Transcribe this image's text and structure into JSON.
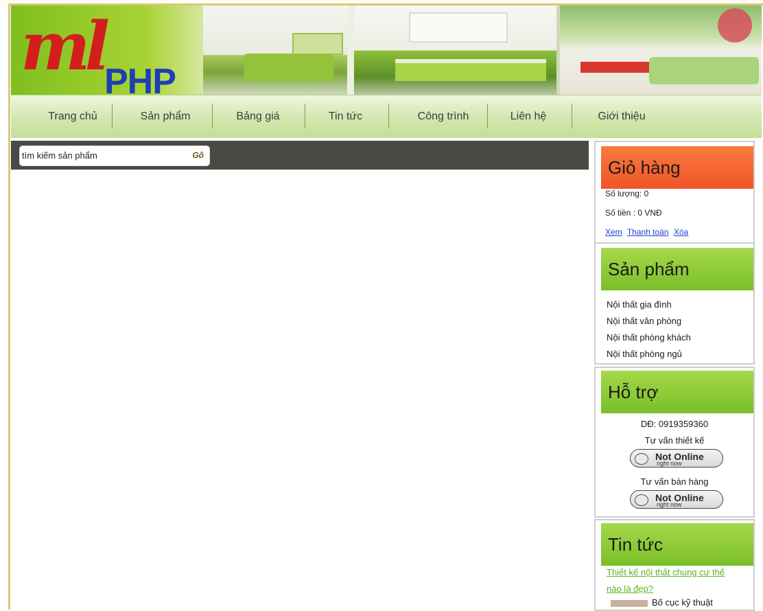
{
  "logo": {
    "ml_text": "ml",
    "php_text": "PHP"
  },
  "nav": {
    "items": [
      "Trang chủ",
      "Sản phẩm",
      "Bảng giá",
      "Tin tức",
      "Công trình",
      "Liên hệ",
      "Giới thiệu"
    ]
  },
  "search": {
    "placeholder": "tìm kiếm sản phẩm",
    "go_label": "Gô"
  },
  "cart": {
    "title": "Giỏ hàng",
    "quantity": "Số lượng: 0",
    "amount": "Số tiền : 0 VNĐ",
    "links": [
      "Xem",
      "Thanh toán",
      "Xóa"
    ]
  },
  "products": {
    "title": "Sản phẩm",
    "items": [
      "Nội thất gia đình",
      "Nội thất văn phòng",
      "Nội thất phòng khách",
      "Nội thất phòng ngủ"
    ]
  },
  "support": {
    "title": "Hỗ trợ",
    "phone": "DĐ: 0919359360",
    "design_label": "Tư vấn thiết kế",
    "sales_label": "Tư vấn bán hàng",
    "status_big": "Not Online",
    "status_small": "right now"
  },
  "news": {
    "title": "Tin tức",
    "link_1": "Thiết kế nội thất chung cư thế",
    "link_2": "nào là đẹp?",
    "more_text": "Bố cục kỹ thuật"
  },
  "colors": {
    "cart_header": "#f0542a",
    "section_header": "#79bf28",
    "nav_bg": "#d2e7ae",
    "search_bar": "#484a44",
    "link_blue": "#1a3fcf",
    "news_link": "#58b423"
  }
}
